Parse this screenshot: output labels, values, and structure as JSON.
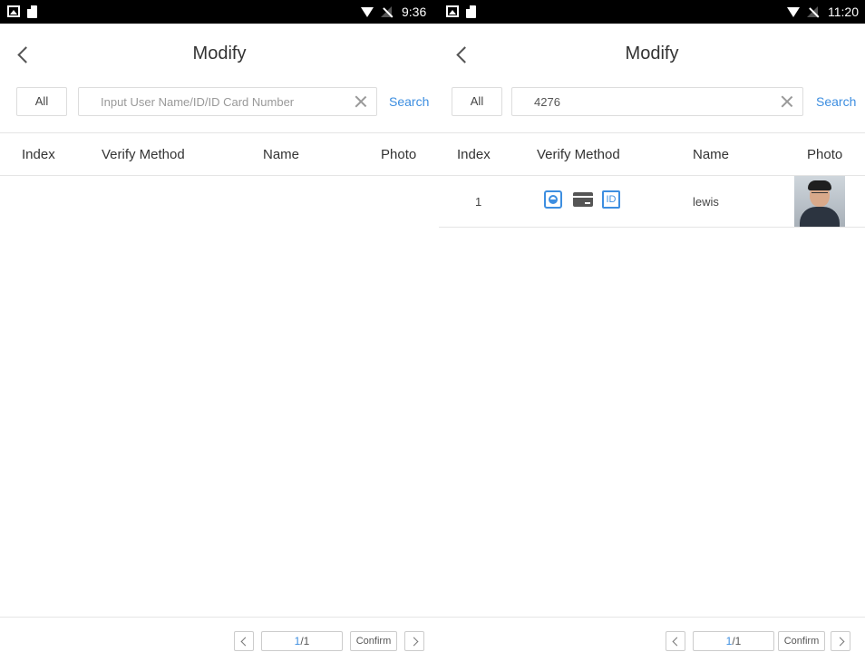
{
  "accent_color": "#3d8ee0",
  "left": {
    "status_time": "9:36",
    "title": "Modify",
    "filter_label": "All",
    "search_placeholder": "Input User Name/ID/ID Card Number",
    "search_value": "",
    "search_label": "Search",
    "columns": [
      "Index",
      "Verify Method",
      "Name",
      "Photo"
    ],
    "pagination": {
      "current": "1",
      "total": "/1"
    },
    "confirm_label": "Confirm"
  },
  "right": {
    "status_time": "11:20",
    "title": "Modify",
    "filter_label": "All",
    "search_value": "4276",
    "search_label": "Search",
    "columns": [
      "Index",
      "Verify Method",
      "Name",
      "Photo"
    ],
    "rows": [
      {
        "index": "1",
        "verify_methods": [
          "face-icon",
          "card-icon",
          "id-icon"
        ],
        "id_icon_text": "ID",
        "name": "lewis"
      }
    ],
    "pagination": {
      "current": "1",
      "total": "/1"
    },
    "confirm_label": "Confirm"
  }
}
